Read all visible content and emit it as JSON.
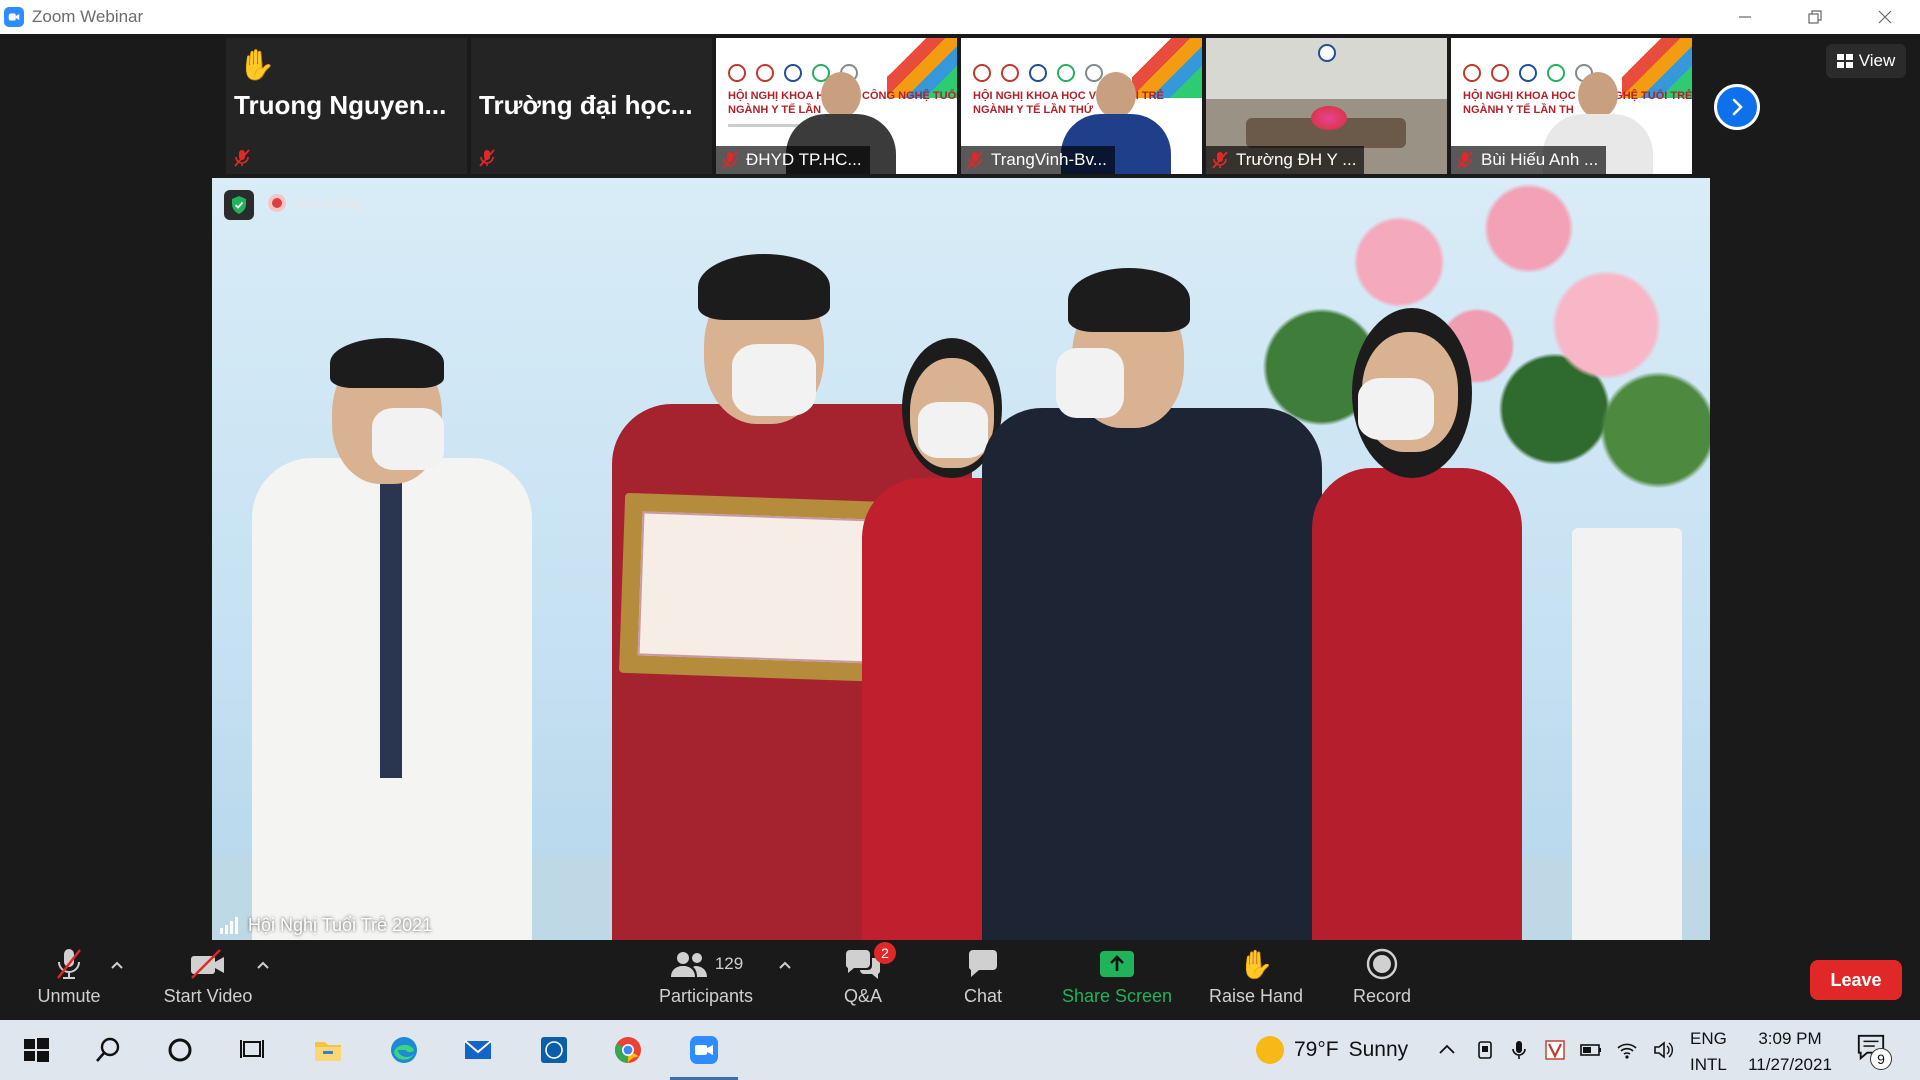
{
  "window": {
    "title": "Zoom Webinar"
  },
  "thumbnails": [
    {
      "name": "Truong Nguyen...",
      "raised_hand": true,
      "muted": true,
      "type": "text"
    },
    {
      "name": "Trường đại học...",
      "raised_hand": false,
      "muted": true,
      "type": "text"
    },
    {
      "name": "ĐHYD TP.HC...",
      "muted": true,
      "type": "banner",
      "banner_line1": "HỘI NGHỊ KHOA HỌC VÀ CÔNG NGHỆ TUỔI TRẺ",
      "banner_line2": "NGÀNH Y TẾ LẦN"
    },
    {
      "name": "TrangVinh-Bv...",
      "muted": true,
      "type": "banner",
      "banner_line1": "HỘI NGHỊ KHOA HỌC VÀ C...  ỔI TRẺ",
      "banner_line2": "NGÀNH Y TẾ LẦN THỨ"
    },
    {
      "name": "Trường ĐH Y ...",
      "muted": true,
      "type": "room"
    },
    {
      "name": "Bùi Hiếu Anh ...",
      "muted": true,
      "type": "banner",
      "banner_line1": "HỘI NGHỊ KHOA HỌC VÀ ...NGHỆ TUỔI TRẺ",
      "banner_line2": "NGÀNH Y TẾ LẦN TH"
    }
  ],
  "view_button": {
    "label": "View"
  },
  "main_video": {
    "recording_label": "Recording",
    "speaker_name": "Hội Nghị Tuổi Trẻ 2021"
  },
  "toolbar": {
    "unmute": "Unmute",
    "start_video": "Start Video",
    "participants_label": "Participants",
    "participants_count": "129",
    "qa": "Q&A",
    "qa_badge": "2",
    "chat": "Chat",
    "share_screen": "Share Screen",
    "raise_hand": "Raise Hand",
    "record": "Record",
    "leave": "Leave"
  },
  "taskbar": {
    "weather_temp": "79°F",
    "weather_text": "Sunny",
    "lang_line1": "ENG",
    "lang_line2": "INTL",
    "time": "3:09 PM",
    "date": "11/27/2021",
    "notification_count": "9"
  },
  "colors": {
    "zoom_blue": "#0e71eb",
    "leave_red": "#e02828",
    "share_green": "#1fb35a"
  }
}
